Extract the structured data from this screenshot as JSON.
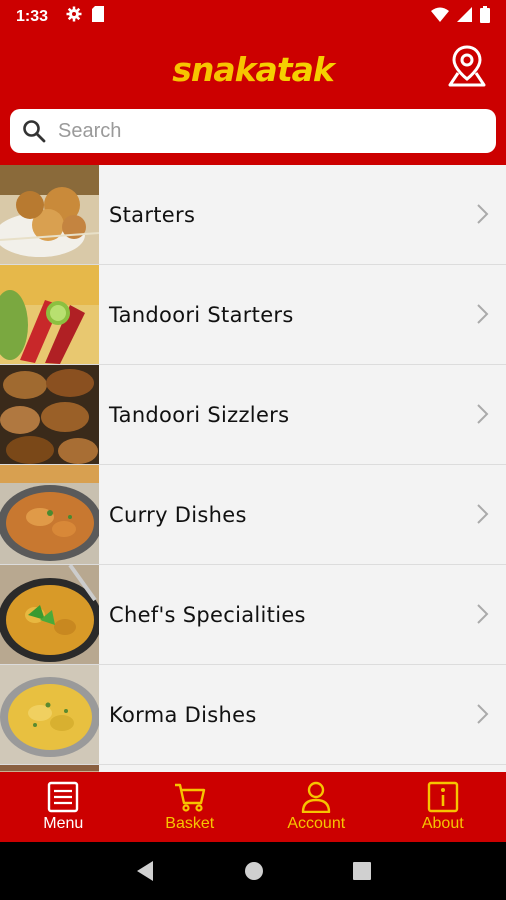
{
  "status_bar": {
    "time": "1:33",
    "left_icons": [
      "gear-icon",
      "sim-card-icon"
    ],
    "right_icons": [
      "wifi-icon",
      "signal-icon",
      "battery-icon"
    ]
  },
  "header": {
    "logo_part1": "snak",
    "logo_part2": "atak",
    "location_icon": "location-pin-icon"
  },
  "search": {
    "placeholder": "Search",
    "value": ""
  },
  "menu": {
    "items": [
      {
        "label": "Starters",
        "image": "starters-photo"
      },
      {
        "label": "Tandoori Starters",
        "image": "tandoori-starters-photo"
      },
      {
        "label": "Tandoori Sizzlers",
        "image": "tandoori-sizzlers-photo"
      },
      {
        "label": "Curry Dishes",
        "image": "curry-dishes-photo"
      },
      {
        "label": "Chef's Specialities",
        "image": "chefs-specialities-photo"
      },
      {
        "label": "Korma Dishes",
        "image": "korma-dishes-photo"
      }
    ]
  },
  "tabs": [
    {
      "label": "Menu",
      "icon": "menu-list-icon",
      "active": true
    },
    {
      "label": "Basket",
      "icon": "cart-icon",
      "active": false
    },
    {
      "label": "Account",
      "icon": "person-icon",
      "active": false
    },
    {
      "label": "About",
      "icon": "info-icon",
      "active": false
    }
  ],
  "colors": {
    "brand_red": "#cc0000",
    "brand_yellow": "#f7c400",
    "list_bg": "#f3f3f3"
  }
}
